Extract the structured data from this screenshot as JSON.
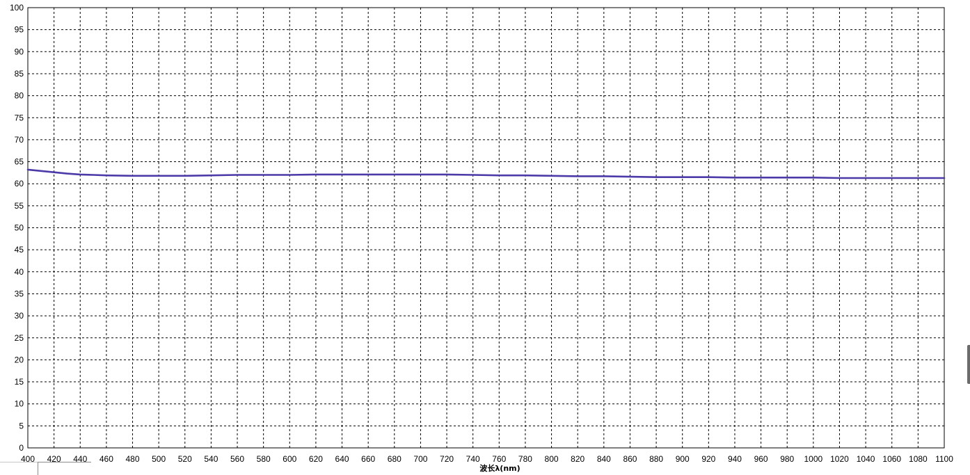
{
  "chart_data": {
    "type": "line",
    "title": "",
    "xlabel": "波长λ(nm)",
    "ylabel": "",
    "xlim": [
      400,
      1100
    ],
    "ylim": [
      0,
      100
    ],
    "x_ticks": [
      400,
      420,
      440,
      460,
      480,
      500,
      520,
      540,
      560,
      580,
      600,
      620,
      640,
      660,
      680,
      700,
      720,
      740,
      760,
      780,
      800,
      820,
      840,
      860,
      880,
      900,
      920,
      940,
      960,
      980,
      1000,
      1020,
      1040,
      1060,
      1080,
      1100
    ],
    "y_ticks": [
      0,
      5,
      10,
      15,
      20,
      25,
      30,
      35,
      40,
      45,
      50,
      55,
      60,
      65,
      70,
      75,
      80,
      85,
      90,
      95,
      100
    ],
    "grid": true,
    "grid_style": "dashed",
    "series": [
      {
        "color": "#4b3aa8",
        "x": [
          400,
          410,
          420,
          430,
          440,
          450,
          460,
          480,
          500,
          520,
          540,
          560,
          580,
          600,
          620,
          640,
          660,
          680,
          700,
          720,
          740,
          760,
          780,
          800,
          820,
          840,
          860,
          880,
          900,
          920,
          940,
          960,
          980,
          1000,
          1020,
          1040,
          1060,
          1080,
          1100
        ],
        "y": [
          63.2,
          62.9,
          62.6,
          62.3,
          62.1,
          62.0,
          61.9,
          61.8,
          61.8,
          61.8,
          61.9,
          62.0,
          62.0,
          62.0,
          62.1,
          62.1,
          62.1,
          62.1,
          62.1,
          62.1,
          62.0,
          61.9,
          61.9,
          61.8,
          61.7,
          61.7,
          61.6,
          61.5,
          61.5,
          61.5,
          61.4,
          61.4,
          61.4,
          61.4,
          61.3,
          61.3,
          61.3,
          61.3,
          61.3
        ]
      }
    ]
  }
}
